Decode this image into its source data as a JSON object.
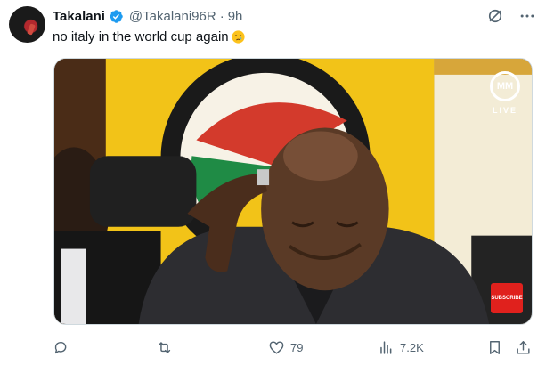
{
  "author": {
    "name": "Takalani",
    "handle": "@Takalani96R",
    "separator": "·",
    "time": "9h"
  },
  "tweet": {
    "text": "no italy in the world cup again"
  },
  "media": {
    "watermark_logo": "MM",
    "watermark_text": "LIVE",
    "subscribe_label": "SUBSCRIBE"
  },
  "actions": {
    "likes": "79",
    "views": "7.2K"
  },
  "icons": {
    "verified": "verified-badge-icon",
    "grok": "grok-icon",
    "more": "more-icon",
    "emoji": "crying-face-emoji",
    "reply": "reply-icon",
    "retweet": "retweet-icon",
    "like": "heart-icon",
    "views": "analytics-icon",
    "bookmark": "bookmark-icon",
    "share": "share-icon"
  },
  "colors": {
    "verified": "#1d9bf0",
    "text_primary": "#0f1419",
    "text_secondary": "#536471",
    "subscribe_red": "#e0211d"
  }
}
